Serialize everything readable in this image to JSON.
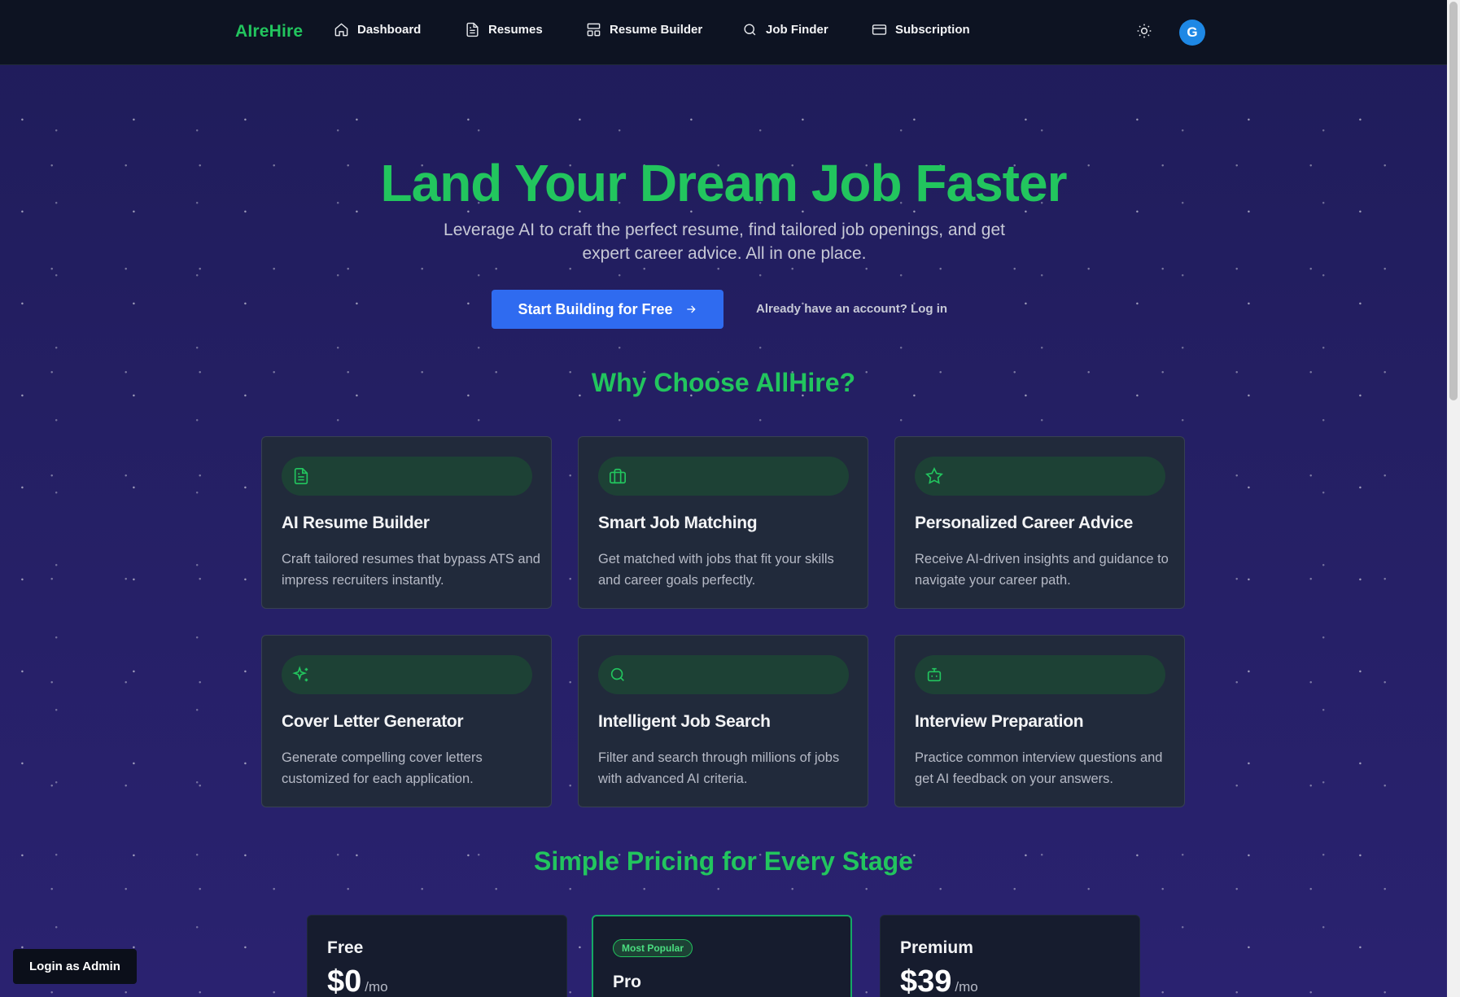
{
  "header": {
    "brand": "AIreHire",
    "nav": [
      {
        "label": "Dashboard",
        "icon": "home-icon"
      },
      {
        "label": "Resumes",
        "icon": "file-text-icon"
      },
      {
        "label": "Resume Builder",
        "icon": "layout-icon"
      },
      {
        "label": "Job Finder",
        "icon": "search-icon"
      },
      {
        "label": "Subscription",
        "icon": "credit-card-icon"
      }
    ],
    "theme_icon": "sun-icon",
    "avatar_initial": "G"
  },
  "hero": {
    "title": "Land Your Dream Job Faster",
    "subtitle": "Leverage AI to craft the perfect resume, find tailored job openings, and get expert career advice. All in one place.",
    "cta_label": "Start Building for Free",
    "login_text": "Already have an account? Log in"
  },
  "features": {
    "title": "Why Choose AllHire?",
    "items": [
      {
        "title": "AI Resume Builder",
        "desc": "Craft tailored resumes that bypass ATS and impress recruiters instantly.",
        "icon": "file-text-icon"
      },
      {
        "title": "Smart Job Matching",
        "desc": "Get matched with jobs that fit your skills and career goals perfectly.",
        "icon": "briefcase-icon"
      },
      {
        "title": "Personalized Career Advice",
        "desc": "Receive AI-driven insights and guidance to navigate your career path.",
        "icon": "star-icon"
      },
      {
        "title": "Cover Letter Generator",
        "desc": "Generate compelling cover letters customized for each application.",
        "icon": "sparkles-icon"
      },
      {
        "title": "Intelligent Job Search",
        "desc": "Filter and search through millions of jobs with advanced AI criteria.",
        "icon": "search-icon"
      },
      {
        "title": "Interview Preparation",
        "desc": "Practice common interview questions and get AI feedback on your answers.",
        "icon": "bot-icon"
      }
    ]
  },
  "pricing": {
    "title": "Simple Pricing for Every Stage",
    "plans": [
      {
        "name": "Free",
        "price": "$0",
        "per": "/mo"
      },
      {
        "name": "Pro",
        "badge": "Most Popular"
      },
      {
        "name": "Premium",
        "price": "$39",
        "per": "/mo"
      }
    ]
  },
  "admin_button": "Login as Admin",
  "colors": {
    "accent": "#22c55e",
    "primary": "#2f6bf0",
    "header_bg": "#0d1322",
    "card_bg": "#212a3b"
  }
}
